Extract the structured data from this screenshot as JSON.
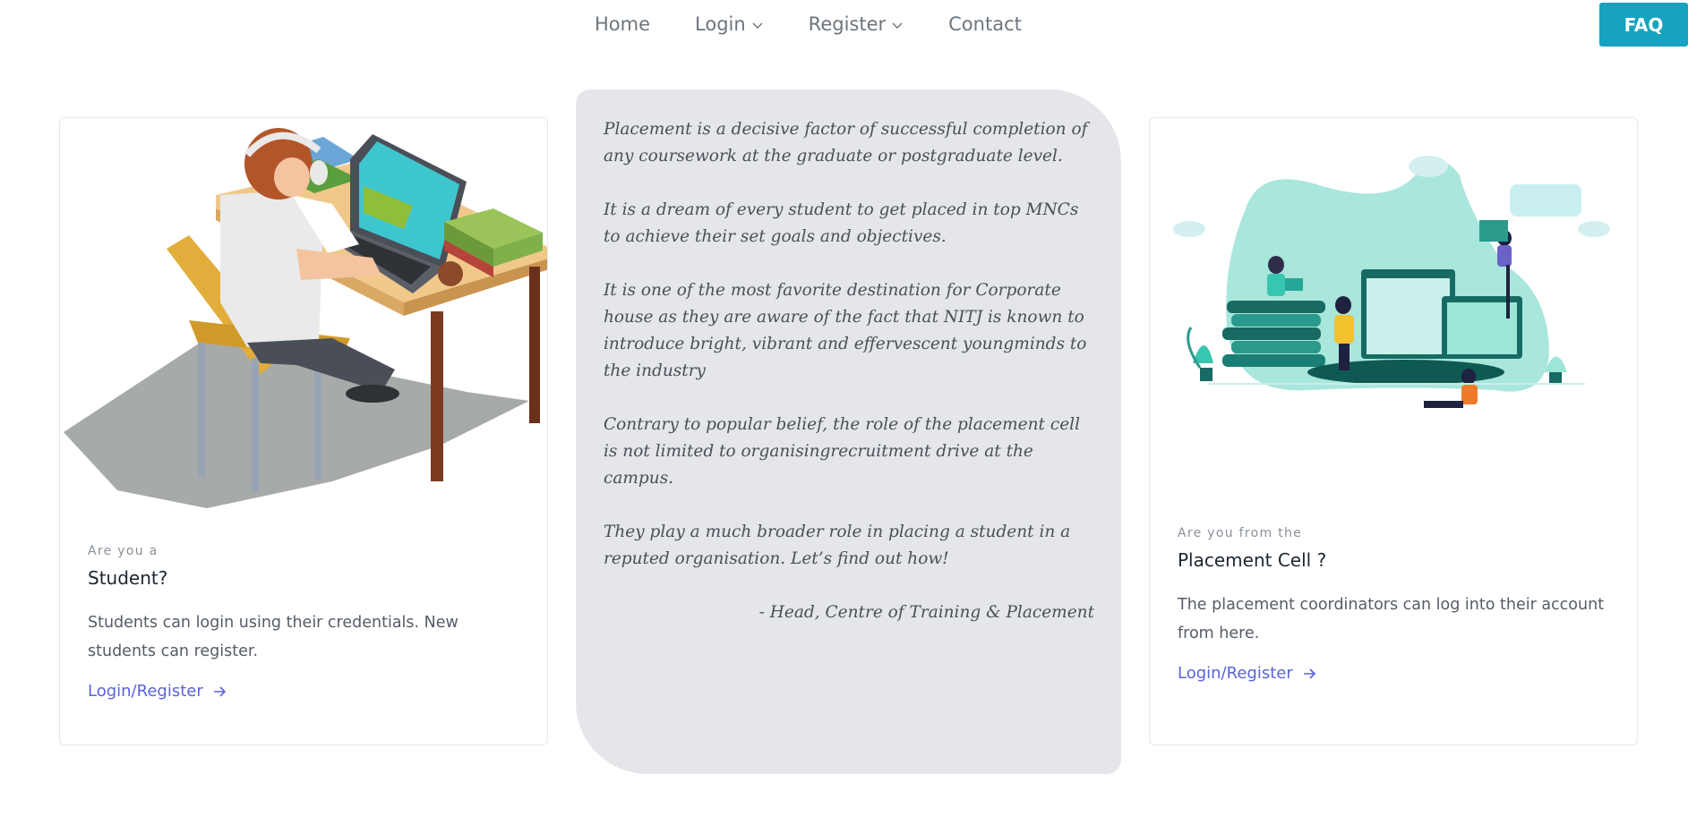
{
  "nav": {
    "items": [
      {
        "label": "Home"
      },
      {
        "label": "Login"
      },
      {
        "label": "Register"
      },
      {
        "label": "Contact"
      }
    ],
    "faq_label": "FAQ"
  },
  "colors": {
    "faq_button": "#17a2c0",
    "link": "#5a63d8",
    "panel": "#e4e6ea"
  },
  "student_card": {
    "illustration": "student-at-laptop-illustration",
    "eyebrow": "Are you a",
    "title": "Student?",
    "description": "Students can login using their credentials. New students can register.",
    "link": "Login/Register"
  },
  "quote": {
    "paragraphs": [
      "Placement is a decisive factor of successful completion of any coursework at the graduate or postgraduate level.",
      "It is a dream of every student to get placed in top MNCs to achieve their set goals and objectives.",
      "It is one of the most favorite destination for Corporate house as they are aware of the fact that NITJ is known to introduce bright, vibrant and effervescent youngminds to the industry",
      "Contrary to popular belief, the role of the placement cell is not limited to organisingrecruitment drive at the campus.",
      "They play a much broader role in placing a student in a reputed organisation. Let’s find out how!"
    ],
    "signature": "- Head, Centre of Training & Placement"
  },
  "cell_card": {
    "illustration": "team-collaboration-illustration",
    "eyebrow": "Are you from the",
    "title": "Placement Cell ?",
    "description": "The placement coordinators can log into their account from here.",
    "link": "Login/Register"
  }
}
